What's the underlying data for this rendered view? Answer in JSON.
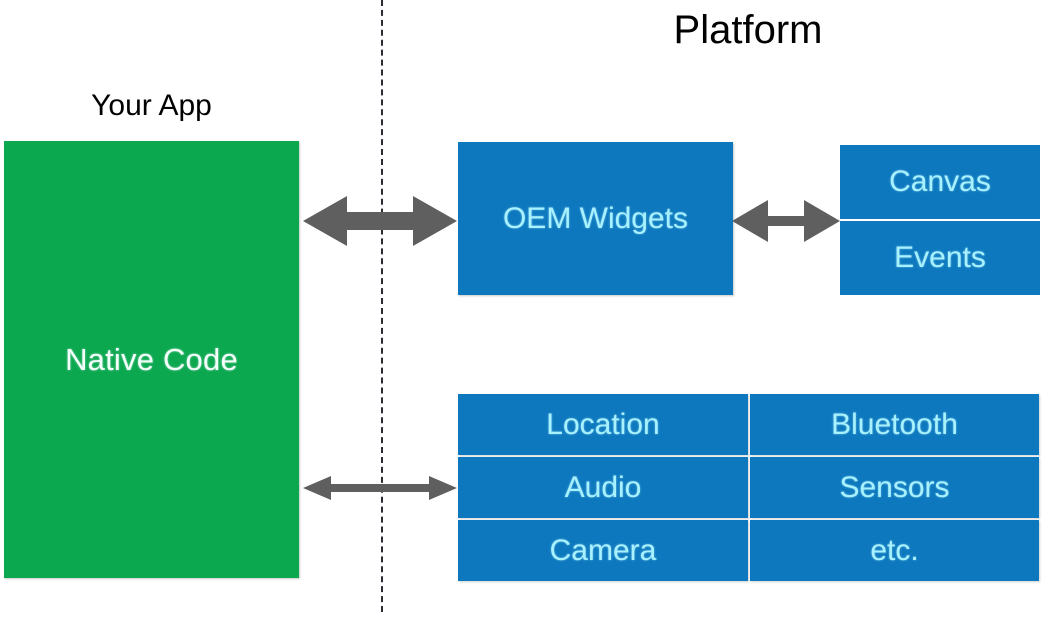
{
  "diagram": {
    "type": "architecture-diagram",
    "background_color": "#ffffff",
    "headings": {
      "platform": "Platform",
      "your_app": "Your App"
    },
    "colors": {
      "app_box": "#0ca850",
      "platform_box": "#0e78be",
      "platform_box_text": "#a8f1ff",
      "app_box_text": "#f2fffa",
      "arrow": "#5f5f5f",
      "divider": "#2b2b33",
      "heading_text": "#010101"
    },
    "app_side": {
      "native_box_label": "Native Code"
    },
    "platform_side": {
      "oem_box_label": "OEM Widgets",
      "canvas_events": [
        {
          "label": "Canvas"
        },
        {
          "label": "Events"
        }
      ],
      "capabilities": [
        {
          "label": "Location"
        },
        {
          "label": "Bluetooth"
        },
        {
          "label": "Audio"
        },
        {
          "label": "Sensors"
        },
        {
          "label": "Camera"
        },
        {
          "label": "etc."
        }
      ]
    },
    "connectors": [
      {
        "name": "app-to-oem-widgets",
        "style": "double-headed-arrow-thick"
      },
      {
        "name": "oem-widgets-to-canvas-events",
        "style": "double-headed-arrow-thick"
      },
      {
        "name": "app-to-capabilities",
        "style": "double-headed-arrow-thin"
      }
    ],
    "divider_line": {
      "name": "app-platform-boundary",
      "style": "vertical-dashed"
    }
  }
}
